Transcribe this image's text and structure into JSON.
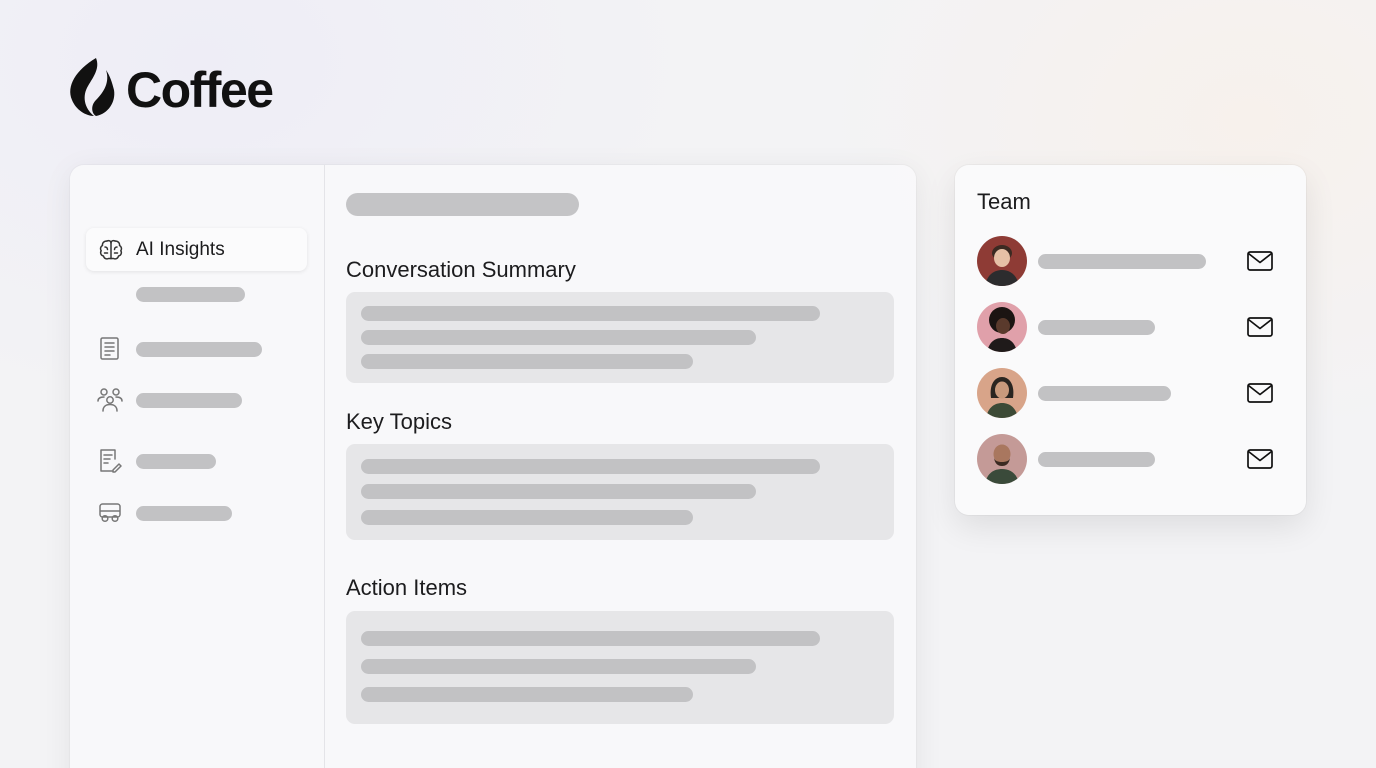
{
  "logo": {
    "text": "Coffee",
    "icon": "coffee-bean-flame-icon"
  },
  "sidebar": {
    "active_item": {
      "label": "AI Insights",
      "icon": "brain-icon"
    },
    "items": [
      {
        "icon": "none"
      },
      {
        "icon": "document-icon"
      },
      {
        "icon": "people-icon"
      },
      {
        "icon": "note-edit-icon"
      },
      {
        "icon": "bus-icon"
      }
    ]
  },
  "main": {
    "sections": [
      {
        "heading": "Conversation Summary"
      },
      {
        "heading": "Key Topics"
      },
      {
        "heading": "Action Items"
      }
    ]
  },
  "team": {
    "title": "Team",
    "members": [
      {
        "avatar_bg": "#8e3b35",
        "action_icon": "mail-icon"
      },
      {
        "avatar_bg": "#e0a0aa",
        "action_icon": "mail-icon"
      },
      {
        "avatar_bg": "#d8a489",
        "action_icon": "mail-icon"
      },
      {
        "avatar_bg": "#c49a97",
        "action_icon": "mail-icon"
      }
    ]
  },
  "colors": {
    "placeholder_bar": "#c2c2c4",
    "section_box": "#e6e6e8",
    "text": "#1c1c1e"
  }
}
